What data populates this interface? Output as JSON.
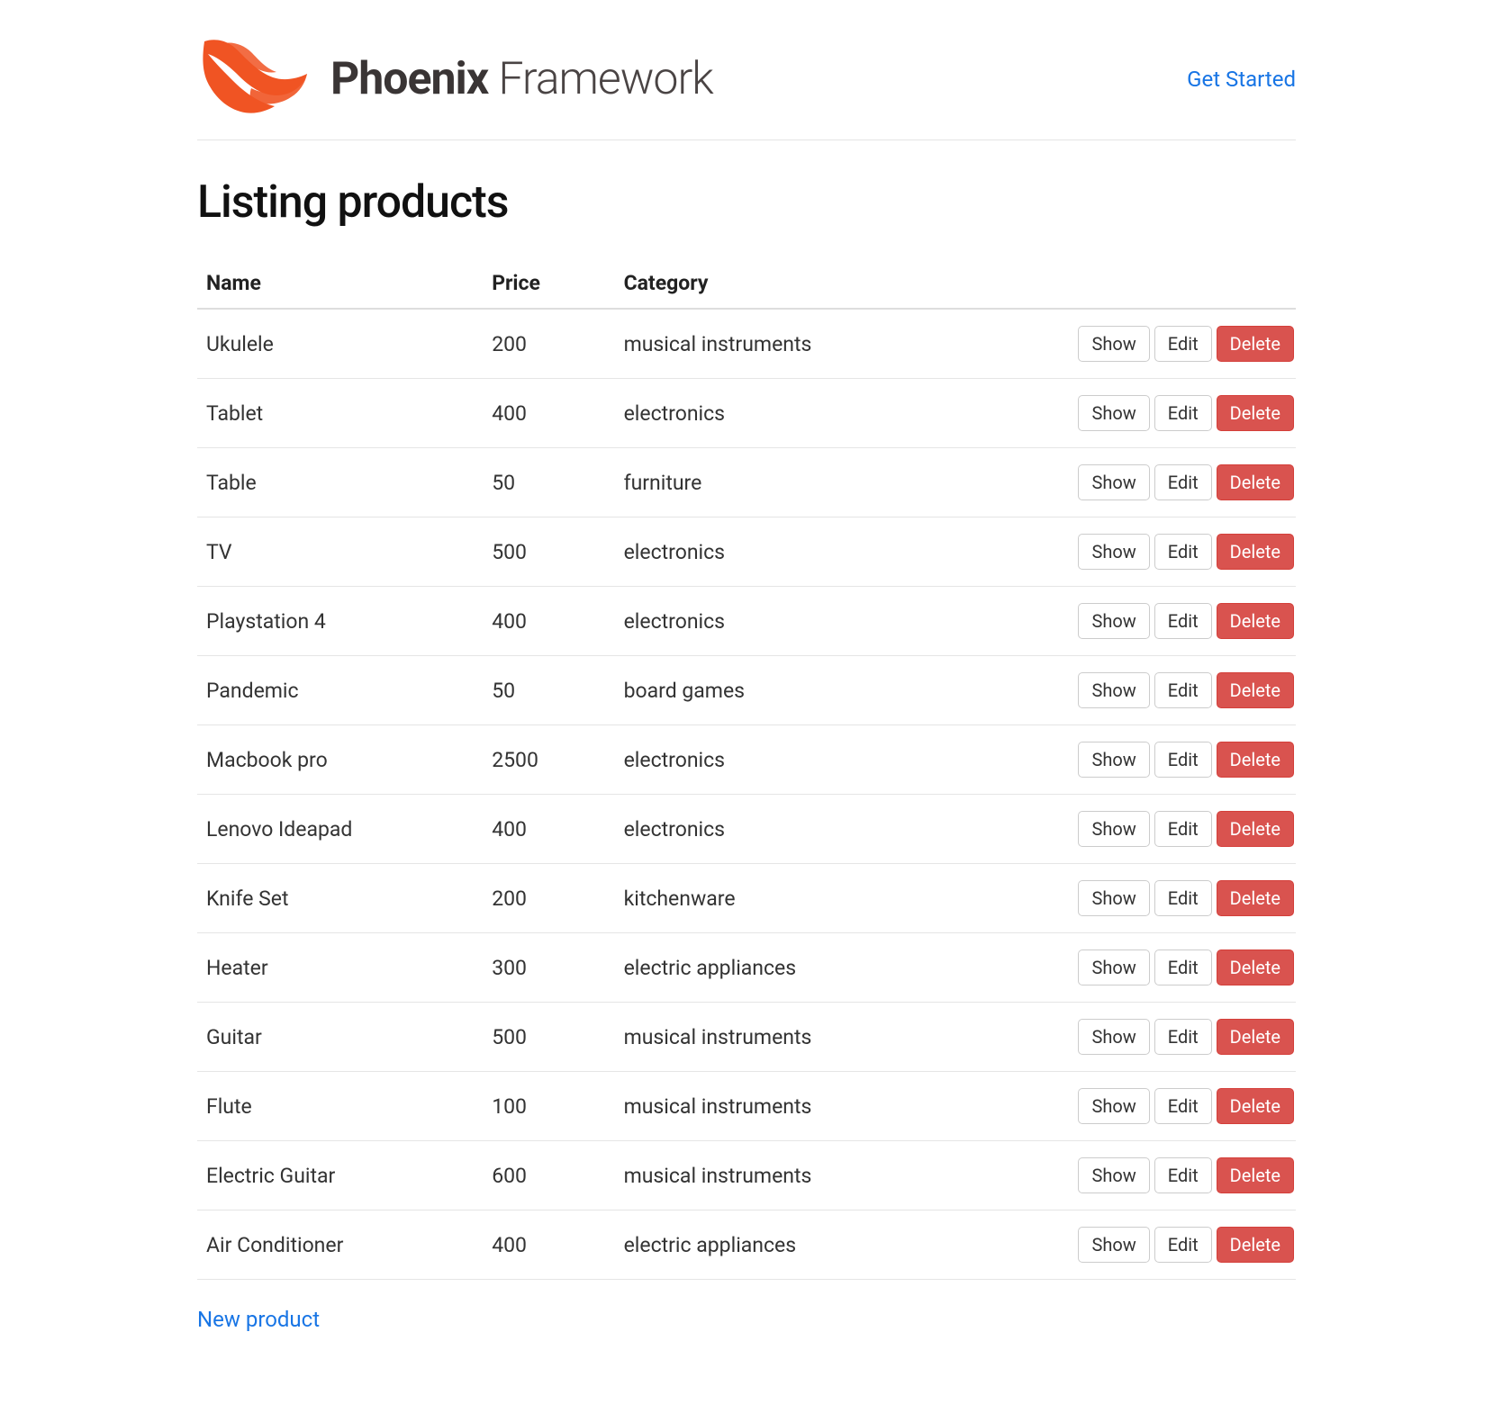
{
  "header": {
    "brand_bold": "Phoenix",
    "brand_light": " Framework",
    "nav_link": "Get Started"
  },
  "page": {
    "title": "Listing products",
    "new_link": "New product"
  },
  "table": {
    "headers": {
      "name": "Name",
      "price": "Price",
      "category": "Category"
    },
    "action_labels": {
      "show": "Show",
      "edit": "Edit",
      "delete": "Delete"
    },
    "rows": [
      {
        "name": "Ukulele",
        "price": "200",
        "category": "musical instruments"
      },
      {
        "name": "Tablet",
        "price": "400",
        "category": "electronics"
      },
      {
        "name": "Table",
        "price": "50",
        "category": "furniture"
      },
      {
        "name": "TV",
        "price": "500",
        "category": "electronics"
      },
      {
        "name": "Playstation 4",
        "price": "400",
        "category": "electronics"
      },
      {
        "name": "Pandemic",
        "price": "50",
        "category": "board games"
      },
      {
        "name": "Macbook pro",
        "price": "2500",
        "category": "electronics"
      },
      {
        "name": "Lenovo Ideapad",
        "price": "400",
        "category": "electronics"
      },
      {
        "name": "Knife Set",
        "price": "200",
        "category": "kitchenware"
      },
      {
        "name": "Heater",
        "price": "300",
        "category": "electric appliances"
      },
      {
        "name": "Guitar",
        "price": "500",
        "category": "musical instruments"
      },
      {
        "name": "Flute",
        "price": "100",
        "category": "musical instruments"
      },
      {
        "name": "Electric Guitar",
        "price": "600",
        "category": "musical instruments"
      },
      {
        "name": "Air Conditioner",
        "price": "400",
        "category": "electric appliances"
      }
    ]
  }
}
